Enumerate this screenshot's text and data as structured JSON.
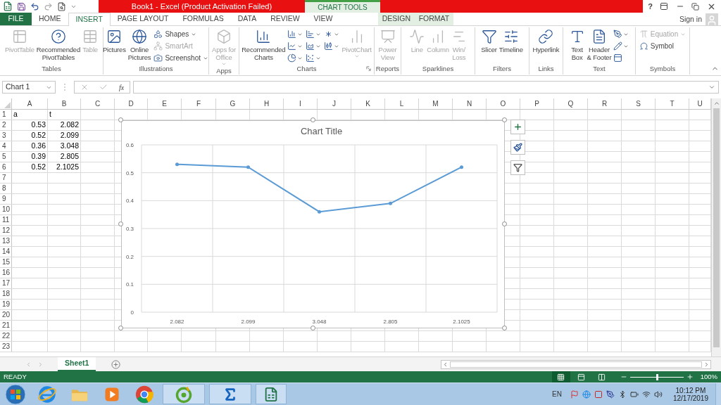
{
  "window": {
    "title": "Book1 -  Excel (Product Activation Failed)",
    "contextual_group": "CHART TOOLS",
    "help": "?"
  },
  "tabs": [
    {
      "label": "FILE",
      "kind": "file",
      "selected": false
    },
    {
      "label": "HOME",
      "kind": "main",
      "selected": false
    },
    {
      "label": "INSERT",
      "kind": "main",
      "selected": true
    },
    {
      "label": "PAGE LAYOUT",
      "kind": "main",
      "selected": false
    },
    {
      "label": "FORMULAS",
      "kind": "main",
      "selected": false
    },
    {
      "label": "DATA",
      "kind": "main",
      "selected": false
    },
    {
      "label": "REVIEW",
      "kind": "main",
      "selected": false
    },
    {
      "label": "VIEW",
      "kind": "main",
      "selected": false
    },
    {
      "label": "DESIGN",
      "kind": "contextual",
      "selected": false
    },
    {
      "label": "FORMAT",
      "kind": "contextual",
      "selected": false
    }
  ],
  "account": {
    "label": "Sign in"
  },
  "ribbon": [
    {
      "label": "Tables",
      "items": [
        {
          "label": "PivotTable",
          "kind": "large",
          "disabled": true,
          "has_menu": false
        },
        {
          "label": "Recommended\nPivotTables",
          "kind": "large",
          "disabled": false,
          "has_menu": false
        },
        {
          "label": "Table",
          "kind": "large",
          "disabled": true,
          "has_menu": false
        }
      ]
    },
    {
      "label": "Illustrations",
      "items": [
        {
          "label": "Pictures",
          "kind": "large",
          "disabled": false,
          "has_menu": false
        },
        {
          "label": "Online\nPictures",
          "kind": "large",
          "disabled": false,
          "has_menu": false
        },
        {
          "label": "Shapes",
          "kind": "small",
          "disabled": false,
          "has_menu": true
        },
        {
          "label": "SmartArt",
          "kind": "small",
          "disabled": true,
          "has_menu": false
        },
        {
          "label": "Screenshot",
          "kind": "small",
          "disabled": false,
          "has_menu": true
        }
      ]
    },
    {
      "label": "Apps",
      "items": [
        {
          "label": "Apps for\nOffice",
          "kind": "large",
          "disabled": true,
          "has_menu": true
        }
      ]
    },
    {
      "label": "Charts",
      "launcher": true,
      "items": [
        {
          "label": "Recommended\nCharts",
          "kind": "large",
          "disabled": false,
          "has_menu": false
        },
        {
          "kind": "icon",
          "disabled": false,
          "has_menu": true
        },
        {
          "kind": "icon",
          "disabled": false,
          "has_menu": true
        },
        {
          "kind": "icon",
          "disabled": false,
          "has_menu": true
        },
        {
          "kind": "icon",
          "disabled": false,
          "has_menu": true
        },
        {
          "kind": "icon",
          "disabled": false,
          "has_menu": true
        },
        {
          "kind": "icon",
          "disabled": false,
          "has_menu": true
        },
        {
          "kind": "icon",
          "disabled": false,
          "has_menu": true
        },
        {
          "kind": "icon",
          "disabled": false,
          "has_menu": true
        },
        {
          "label": "PivotChart",
          "kind": "large",
          "disabled": true,
          "has_menu": true
        }
      ]
    },
    {
      "label": "Reports",
      "items": [
        {
          "label": "Power\nView",
          "kind": "large",
          "disabled": true,
          "has_menu": false
        }
      ]
    },
    {
      "label": "Sparklines",
      "items": [
        {
          "label": "Line",
          "kind": "large",
          "disabled": true,
          "has_menu": false
        },
        {
          "label": "Column",
          "kind": "large",
          "disabled": true,
          "has_menu": false
        },
        {
          "label": "Win/\nLoss",
          "kind": "large",
          "disabled": true,
          "has_menu": false
        }
      ]
    },
    {
      "label": "Filters",
      "items": [
        {
          "label": "Slicer",
          "kind": "large",
          "disabled": false,
          "has_menu": false
        },
        {
          "label": "Timeline",
          "kind": "large",
          "disabled": false,
          "has_menu": false
        }
      ]
    },
    {
      "label": "Links",
      "items": [
        {
          "label": "Hyperlink",
          "kind": "large",
          "disabled": false,
          "has_menu": false
        }
      ]
    },
    {
      "label": "Text",
      "items": [
        {
          "label": "Text\nBox",
          "kind": "large",
          "disabled": false,
          "has_menu": false
        },
        {
          "label": "Header\n& Footer",
          "kind": "large",
          "disabled": false,
          "has_menu": false
        },
        {
          "kind": "icon",
          "disabled": false,
          "has_menu": true
        },
        {
          "kind": "icon",
          "disabled": false,
          "has_menu": true
        },
        {
          "kind": "icon",
          "disabled": false,
          "has_menu": false
        }
      ]
    },
    {
      "label": "Symbols",
      "items": [
        {
          "label": "Equation",
          "kind": "small",
          "disabled": true,
          "has_menu": true
        },
        {
          "label": "Symbol",
          "kind": "small",
          "disabled": false,
          "has_menu": false
        }
      ]
    }
  ],
  "formula_bar": {
    "name_box": "Chart 1",
    "function_label": "fx"
  },
  "columns": [
    "A",
    "B",
    "C",
    "D",
    "E",
    "F",
    "G",
    "H",
    "I",
    "J",
    "K",
    "L",
    "M",
    "N",
    "O",
    "P",
    "Q",
    "R",
    "S",
    "T",
    "U"
  ],
  "rows": [
    {
      "label": "1",
      "cells": [
        {
          "value": "a",
          "kind": "text"
        },
        {
          "value": "t",
          "kind": "text"
        }
      ]
    },
    {
      "label": "2",
      "cells": [
        {
          "value": "0.53",
          "kind": "number"
        },
        {
          "value": "2.082",
          "kind": "number"
        }
      ]
    },
    {
      "label": "3",
      "cells": [
        {
          "value": "0.52",
          "kind": "number"
        },
        {
          "value": "2.099",
          "kind": "number"
        }
      ]
    },
    {
      "label": "4",
      "cells": [
        {
          "value": "0.36",
          "kind": "number"
        },
        {
          "value": "3.048",
          "kind": "number"
        }
      ]
    },
    {
      "label": "5",
      "cells": [
        {
          "value": "0.39",
          "kind": "number"
        },
        {
          "value": "2.805",
          "kind": "number"
        }
      ]
    },
    {
      "label": "6",
      "cells": [
        {
          "value": "0.52",
          "kind": "number"
        },
        {
          "value": "2.1025",
          "kind": "number"
        }
      ]
    },
    {
      "label": "7",
      "cells": []
    },
    {
      "label": "8",
      "cells": []
    },
    {
      "label": "9",
      "cells": []
    },
    {
      "label": "10",
      "cells": []
    },
    {
      "label": "11",
      "cells": []
    },
    {
      "label": "12",
      "cells": []
    },
    {
      "label": "13",
      "cells": []
    },
    {
      "label": "14",
      "cells": []
    },
    {
      "label": "15",
      "cells": []
    },
    {
      "label": "16",
      "cells": []
    },
    {
      "label": "17",
      "cells": []
    },
    {
      "label": "18",
      "cells": []
    },
    {
      "label": "19",
      "cells": []
    },
    {
      "label": "20",
      "cells": []
    },
    {
      "label": "21",
      "cells": []
    },
    {
      "label": "22",
      "cells": []
    },
    {
      "label": "23",
      "cells": []
    }
  ],
  "chart": {
    "chart_data": {
      "type": "line",
      "title": "Chart Title",
      "categories": [
        "2.082",
        "2.099",
        "3.048",
        "2.805",
        "2.1025"
      ],
      "series": [
        {
          "color": "#5b9bd5",
          "values": [
            0.53,
            0.52,
            0.36,
            0.39,
            0.52
          ]
        }
      ],
      "ylim": [
        0,
        0.6
      ],
      "yticks": [
        0,
        0.1,
        0.2,
        0.3,
        0.4,
        0.5,
        0.6
      ],
      "grid": true
    }
  },
  "sheet_tabs": [
    {
      "label": "Sheet1",
      "selected": true
    }
  ],
  "status_bar": {
    "status": "READY",
    "views": [
      {
        "selected": true
      },
      {
        "selected": false
      },
      {
        "selected": false
      }
    ],
    "zoom_slider": {
      "level": 0.5
    },
    "zoom": "100%"
  },
  "taskbar": {
    "language": "EN",
    "time": "10:12 PM",
    "date": "12/17/2019"
  }
}
